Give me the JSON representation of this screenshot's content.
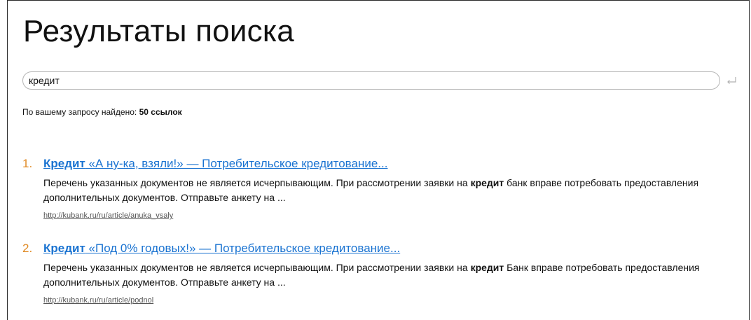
{
  "page": {
    "title": "Результаты поиска"
  },
  "search": {
    "value": "кредит"
  },
  "summary": {
    "prefix": "По вашему запросу найдено:",
    "count": "50 ссылок"
  },
  "results": [
    {
      "num": "1.",
      "title_keyword": "Кредит",
      "title_rest": " «А ну-ка, взяли!» — Потребительское кредитование...",
      "snippet_before": "Перечень указанных документов не является исчерпывающим. При рассмотрении заявки на ",
      "snippet_keyword": "кредит",
      "snippet_after": " банк вправе потребовать предоставления дополнительных документов. Отправьте анкету на ...",
      "url": "http://kubank.ru/ru/article/anuka_vsaly"
    },
    {
      "num": "2.",
      "title_keyword": "Кредит",
      "title_rest": " «Под 0% годовых!» — Потребительское кредитование...",
      "snippet_before": "Перечень указанных документов не является исчерпывающим. При рассмотрении заявки на ",
      "snippet_keyword": "кредит",
      "snippet_after": " Банк вправе потребовать предоставления дополнительных документов. Отправьте анкету на ...",
      "url": "http://kubank.ru/ru/article/podnol"
    }
  ],
  "icons": {
    "submit": "enter-icon"
  },
  "colors": {
    "link": "#1a73d1",
    "number": "#e08a25"
  }
}
